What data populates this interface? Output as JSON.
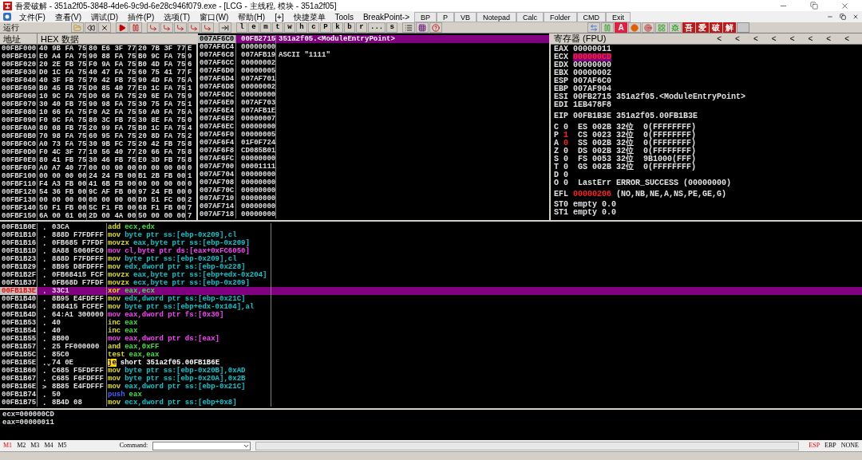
{
  "window": {
    "title": "吾爱破解 - 351a2f05-3848-4de6-9c9d-6e28c946f079.exe - [LCG - 主线程, 模块 - 351a2f05]"
  },
  "menu": [
    "文件(F)",
    "查看(V)",
    "调试(D)",
    "插件(P)",
    "选项(T)",
    "窗口(W)",
    "帮助(H)",
    "[+]",
    "快捷菜单",
    "Tools",
    "BreakPoint->"
  ],
  "quick_buttons": [
    "BP",
    "P",
    "VB",
    "Notepad",
    "Calc",
    "Folder",
    "CMD",
    "Exit"
  ],
  "toolbar": {
    "status": "运行",
    "letter_buttons": [
      "l",
      "e",
      "m",
      "t",
      "w",
      "h",
      "c",
      "P",
      "k",
      "b",
      "r",
      "...",
      "s"
    ],
    "plugin_tiles": [
      "A",
      "吾",
      "爱",
      "破",
      "解"
    ]
  },
  "dump": {
    "columns": [
      "地址",
      "HEX 数据"
    ],
    "rows": [
      {
        "address": "00FBF000",
        "groups": [
          "40 9B FA 75",
          "80 E6 3F 77",
          "20 7B 3F 77",
          "E"
        ]
      },
      {
        "address": "00FBF010",
        "groups": [
          "E0 A4 FA 75",
          "90 88 FA 75",
          "B0 9C FA 75",
          "9"
        ]
      },
      {
        "address": "00FBF020",
        "groups": [
          "20 2E FB 75",
          "F0 9A FA 75",
          "B0 4D FA 75",
          "6"
        ]
      },
      {
        "address": "00FBF030",
        "groups": [
          "D0 1C FA 75",
          "40 47 FA 75",
          "60 75 41 77",
          "F"
        ]
      },
      {
        "address": "00FBF040",
        "groups": [
          "40 3F FB 75",
          "70 42 FB 75",
          "90 4D FA 75",
          "A"
        ]
      },
      {
        "address": "00FBF050",
        "groups": [
          "B0 45 FB 75",
          "D0 85 40 77",
          "E0 1C FA 75",
          "1"
        ]
      },
      {
        "address": "00FBF060",
        "groups": [
          "10 9C FA 75",
          "D0 66 FA 75",
          "20 6E FA 75",
          "9"
        ]
      },
      {
        "address": "00FBF070",
        "groups": [
          "30 40 FB 75",
          "90 98 FA 75",
          "30 75 FA 75",
          "1"
        ]
      },
      {
        "address": "00FBF080",
        "groups": [
          "10 66 FA 75",
          "F0 A2 FA 75",
          "50 A0 FA 75",
          "A"
        ]
      },
      {
        "address": "00FBF090",
        "groups": [
          "F0 9C FA 75",
          "80 3C FB 75",
          "30 8E FA 75",
          "0"
        ]
      },
      {
        "address": "00FBF0A0",
        "groups": [
          "80 08 FB 75",
          "20 99 FA 75",
          "B0 1C FA 75",
          "4"
        ]
      },
      {
        "address": "00FBF0B0",
        "groups": [
          "70 98 FA 75",
          "60 95 FA 75",
          "20 8D FA 75",
          "2"
        ]
      },
      {
        "address": "00FBF0C0",
        "groups": [
          "A0 73 FA 75",
          "30 9B FC 75",
          "20 42 FB 75",
          "8"
        ]
      },
      {
        "address": "00FBF0D0",
        "groups": [
          "F0 4C 3F 77",
          "10 56 40 77",
          "20 66 FA 75",
          "8"
        ]
      },
      {
        "address": "00FBF0E0",
        "groups": [
          "80 41 FB 75",
          "30 46 FB 75",
          "E0 3D FB 75",
          "8"
        ]
      },
      {
        "address": "00FBF0F0",
        "groups": [
          "A0 A7 40 77",
          "00 00 00 00",
          "00 00 00 00",
          "0"
        ]
      },
      {
        "address": "00FBF100",
        "groups": [
          "00 00 00 00",
          "24 24 FB 00",
          "B1 2B FB 00",
          "1"
        ]
      },
      {
        "address": "00FBF110",
        "groups": [
          "F4 A3 FB 00",
          "41 6B FB 00",
          "00 00 00 00",
          "0"
        ]
      },
      {
        "address": "00FBF120",
        "groups": [
          "54 36 FB 00",
          "9C AF FB 00",
          "97 24 FB 00",
          "0"
        ]
      },
      {
        "address": "00FBF130",
        "groups": [
          "00 00 00 00",
          "00 00 00 00",
          "D0 51 FC 00",
          "2"
        ]
      },
      {
        "address": "00FBF140",
        "groups": [
          "50 F1 FB 00",
          "5C F1 FB 00",
          "68 F1 FB 00",
          "7"
        ]
      },
      {
        "address": "00FBF150",
        "groups": [
          "6A 00 61 00",
          "2D 00 4A 00",
          "50 00 00 00",
          "7"
        ]
      }
    ]
  },
  "stack": {
    "rows": [
      {
        "address": "007AF6C0",
        "value": "00FB2715",
        "comment": "351a2f05.<ModuleEntryPoint>",
        "selected": true
      },
      {
        "address": "007AF6C4",
        "value": "00000000",
        "selected": false
      },
      {
        "address": "007AF6C8",
        "value": "007AFB19",
        "comment": "ASCII \"1111\"",
        "selected": false
      },
      {
        "address": "007AF6CC",
        "value": "00000002",
        "selected": false
      },
      {
        "address": "007AF6D0",
        "value": "00000005",
        "selected": false
      },
      {
        "address": "007AF6D4",
        "value": "007AF701",
        "selected": false
      },
      {
        "address": "007AF6D8",
        "value": "00000002",
        "selected": false
      },
      {
        "address": "007AF6DC",
        "value": "00000000",
        "selected": false
      },
      {
        "address": "007AF6E0",
        "value": "007AF703",
        "selected": false
      },
      {
        "address": "007AF6E4",
        "value": "007AFB1E",
        "selected": false
      },
      {
        "address": "007AF6E8",
        "value": "00000007",
        "selected": false
      },
      {
        "address": "007AF6EC",
        "value": "00000000",
        "selected": false
      },
      {
        "address": "007AF6F0",
        "value": "00000005",
        "selected": false
      },
      {
        "address": "007AF6F4",
        "value": "01F0F724",
        "selected": false
      },
      {
        "address": "007AF6F8",
        "value": "CD085B01",
        "selected": false
      },
      {
        "address": "007AF6FC",
        "value": "00000000",
        "selected": false
      },
      {
        "address": "007AF700",
        "value": "00001111",
        "selected": false
      },
      {
        "address": "007AF704",
        "value": "00000000",
        "selected": false
      },
      {
        "address": "007AF708",
        "value": "00000000",
        "selected": false
      },
      {
        "address": "007AF70C",
        "value": "00000000",
        "selected": false
      },
      {
        "address": "007AF710",
        "value": "00000000",
        "selected": false
      },
      {
        "address": "007AF714",
        "value": "00000000",
        "selected": false
      },
      {
        "address": "007AF718",
        "value": "00000000",
        "selected": false
      }
    ]
  },
  "registers": {
    "title": "寄存器 (FPU)",
    "arrows": [
      "<",
      "<",
      "<",
      "<",
      "<",
      "<",
      "<",
      "<"
    ],
    "rows": [
      {
        "name": "EAX",
        "value": "00000011",
        "changed": false,
        "selected": false
      },
      {
        "name": "ECX",
        "value": "000000CD",
        "changed": true,
        "selected": true
      },
      {
        "name": "EDX",
        "value": "00000000",
        "changed": false,
        "selected": false
      },
      {
        "name": "EBX",
        "value": "00000002",
        "changed": false,
        "selected": false
      },
      {
        "name": "ESP",
        "value": "007AF6C0",
        "changed": false,
        "selected": false
      },
      {
        "name": "EBP",
        "value": "007AF904",
        "changed": false,
        "selected": false
      },
      {
        "name": "ESI",
        "value": "00FB2715",
        "comment": "351a2f05.<ModuleEntryPoint>",
        "changed": false,
        "selected": false
      },
      {
        "name": "EDI",
        "value": "1EB478F8",
        "changed": false,
        "selected": false
      }
    ],
    "eip": {
      "name": "EIP",
      "value": "00FB1B3E",
      "comment": "351a2f05.00FB1B3E"
    },
    "flags": [
      {
        "name": "C",
        "value": "0",
        "changed": false,
        "detail": "ES 002B 32位  0(FFFFFFFF)"
      },
      {
        "name": "P",
        "value": "1",
        "changed": true,
        "detail": "CS 0023 32位  0(FFFFFFFF)"
      },
      {
        "name": "A",
        "value": "0",
        "changed": true,
        "detail": "SS 002B 32位  0(FFFFFFFF)"
      },
      {
        "name": "Z",
        "value": "0",
        "changed": false,
        "detail": "DS 002B 32位  0(FFFFFFFF)"
      },
      {
        "name": "S",
        "value": "0",
        "changed": false,
        "detail": "FS 0053 32位  9B1000(FFF)"
      },
      {
        "name": "T",
        "value": "0",
        "changed": false,
        "detail": "GS 002B 32位  0(FFFFFFFF)"
      },
      {
        "name": "D",
        "value": "0",
        "changed": false
      },
      {
        "name": "O",
        "value": "0",
        "changed": false,
        "detail": "LastErr ERROR_SUCCESS (00000000)"
      }
    ],
    "efl": {
      "name": "EFL",
      "value": "00000206",
      "changed": true,
      "decoded": "(NO,NB,NE,A,NS,PE,GE,G)"
    },
    "fpu": [
      "ST0 empty 0.0",
      "ST1 empty 0.0"
    ]
  },
  "disassembly": {
    "rows": [
      {
        "address": "00FB1B0E",
        "marker": ".",
        "hex": "03CA",
        "mnemonic": "add",
        "operands": "ecx,edx",
        "kind": "arith",
        "selected": false
      },
      {
        "address": "00FB1B10",
        "marker": ".",
        "hex": "888D F7FDFFF",
        "mnemonic": "mov",
        "operands": "byte ptr ss:[ebp-0x209],cl",
        "kind": "stack",
        "selected": false
      },
      {
        "address": "00FB1B16",
        "marker": ".",
        "hex": "0FB685 F7FDF",
        "mnemonic": "movzx",
        "operands": "eax,byte ptr ss:[ebp-0x209]",
        "kind": "stack",
        "selected": false
      },
      {
        "address": "00FB1B1D",
        "marker": ".",
        "hex": "8A88 5060FC0",
        "mnemonic": "mov",
        "operands": "cl,byte ptr ds:[eax+0xFC6050]",
        "kind": "memory",
        "selected": false
      },
      {
        "address": "00FB1B23",
        "marker": ".",
        "hex": "888D F7FDFFF",
        "mnemonic": "mov",
        "operands": "byte ptr ss:[ebp-0x209],cl",
        "kind": "stack",
        "selected": false
      },
      {
        "address": "00FB1B29",
        "marker": ".",
        "hex": "8B95 D8FDFFF",
        "mnemonic": "mov",
        "operands": "edx,dword ptr ss:[ebp-0x228]",
        "kind": "stack",
        "selected": false
      },
      {
        "address": "00FB1B2F",
        "marker": ".",
        "hex": "0FB68415 FCF",
        "mnemonic": "movzx",
        "operands": "eax,byte ptr ss:[ebp+edx-0x204]",
        "kind": "stack",
        "selected": false
      },
      {
        "address": "00FB1B37",
        "marker": ".",
        "hex": "0FB68D F7FDF",
        "mnemonic": "movzx",
        "operands": "ecx,byte ptr ss:[ebp-0x209]",
        "kind": "stack",
        "selected": false
      },
      {
        "address": "00FB1B3E",
        "marker": ".",
        "hex": "33C1",
        "mnemonic": "xor",
        "operands": "eax,ecx",
        "kind": "arith",
        "selected": true
      },
      {
        "address": "00FB1B40",
        "marker": ".",
        "hex": "8B95 E4FDFFF",
        "mnemonic": "mov",
        "operands": "edx,dword ptr ss:[ebp-0x21C]",
        "kind": "stack",
        "selected": false
      },
      {
        "address": "00FB1B46",
        "marker": ".",
        "hex": "888415 FCFEF",
        "mnemonic": "mov",
        "operands": "byte ptr ss:[ebp+edx-0x104],al",
        "kind": "stack",
        "selected": false
      },
      {
        "address": "00FB1B4D",
        "marker": ".",
        "hex": "64:A1 300000",
        "mnemonic": "mov",
        "operands": "eax,dword ptr fs:[0x30]",
        "kind": "memory",
        "selected": false
      },
      {
        "address": "00FB1B53",
        "marker": ".",
        "hex": "40",
        "mnemonic": "inc",
        "operands": "eax",
        "kind": "arith",
        "selected": false
      },
      {
        "address": "00FB1B54",
        "marker": ".",
        "hex": "40",
        "mnemonic": "inc",
        "operands": "eax",
        "kind": "arith",
        "selected": false
      },
      {
        "address": "00FB1B55",
        "marker": ".",
        "hex": "8B00",
        "mnemonic": "mov",
        "operands": "eax,dword ptr ds:[eax]",
        "kind": "memory",
        "selected": false
      },
      {
        "address": "00FB1B57",
        "marker": ".",
        "hex": "25 FF000000",
        "mnemonic": "and",
        "operands": "eax,0xFF",
        "kind": "arith",
        "selected": false
      },
      {
        "address": "00FB1B5C",
        "marker": ".",
        "hex": "85C0",
        "mnemonic": "test",
        "operands": "eax,eax",
        "kind": "arith",
        "selected": false
      },
      {
        "address": "00FB1B5E",
        "marker": ".⌄",
        "hex": "74 0E",
        "mnemonic": "je",
        "operands": "short 351a2f05.00FB1B6E",
        "kind": "jump",
        "selected": false
      },
      {
        "address": "00FB1B60",
        "marker": ".",
        "hex": "C685 F5FDFFF",
        "mnemonic": "mov",
        "operands": "byte ptr ss:[ebp-0x20B],0xAD",
        "kind": "stack",
        "selected": false
      },
      {
        "address": "00FB1B67",
        "marker": ".",
        "hex": "C685 F6FDFFF",
        "mnemonic": "mov",
        "operands": "byte ptr ss:[ebp-0x20A],0x2B",
        "kind": "stack",
        "selected": false
      },
      {
        "address": "00FB1B6E",
        "marker": ">",
        "hex": "8B85 E4FDFFF",
        "mnemonic": "mov",
        "operands": "eax,dword ptr ss:[ebp-0x21C]",
        "kind": "stack",
        "selected": false
      },
      {
        "address": "00FB1B74",
        "marker": ".",
        "hex": "50",
        "mnemonic": "push",
        "operands": "eax",
        "kind": "push",
        "selected": false
      },
      {
        "address": "00FB1B75",
        "marker": ".",
        "hex": "8B4D 08",
        "mnemonic": "mov",
        "operands": "ecx,dword ptr ss:[ebp+0x8]",
        "kind": "stack",
        "selected": false
      }
    ]
  },
  "command_output": [
    "ecx=000000CD",
    "eax=00000011"
  ],
  "status_bar": {
    "marks": [
      {
        "label": "M1",
        "selected": true
      },
      {
        "label": "M2",
        "selected": false
      },
      {
        "label": "M3",
        "selected": false
      },
      {
        "label": "M4",
        "selected": false
      },
      {
        "label": "M5",
        "selected": false
      }
    ],
    "command_label": "Command:",
    "anchors": [
      {
        "label": "ESP",
        "selected": true
      },
      {
        "label": "EBP",
        "selected": false
      },
      {
        "label": "NONE",
        "selected": false
      }
    ]
  }
}
